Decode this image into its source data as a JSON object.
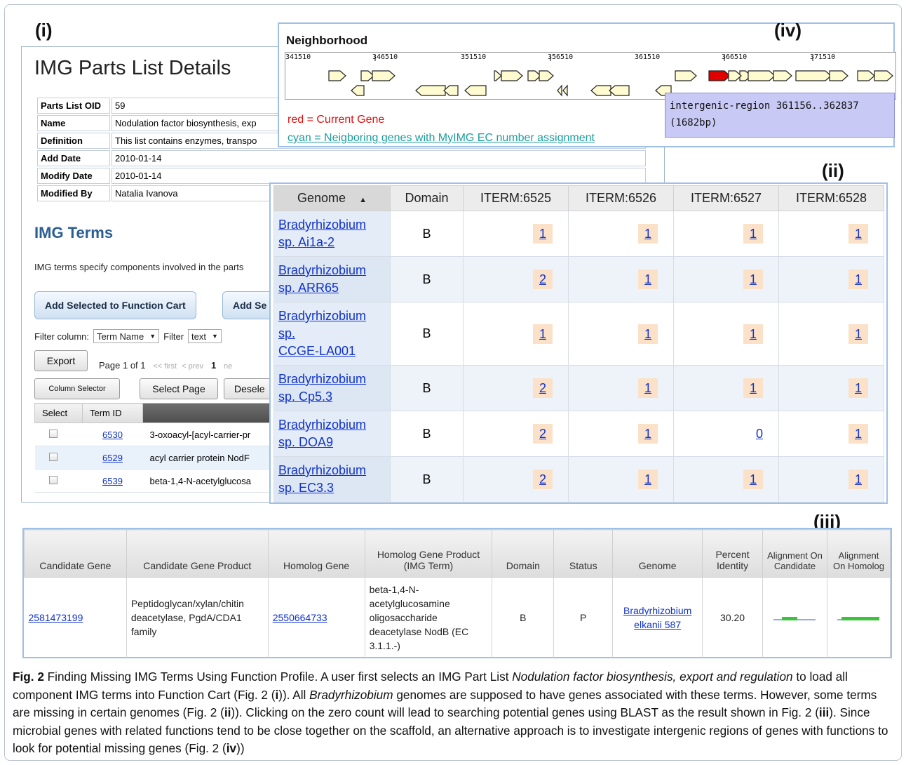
{
  "labels": {
    "i": "(i)",
    "ii": "(ii)",
    "iii": "(iii)",
    "iv": "(iv)"
  },
  "panel_i": {
    "title": "IMG Parts List Details",
    "info": [
      {
        "key": "Parts List OID",
        "value": "59"
      },
      {
        "key": "Name",
        "value": "Nodulation factor biosynthesis, exp"
      },
      {
        "key": "Definition",
        "value": "This list contains enzymes, transpo"
      },
      {
        "key": "Add Date",
        "value": "2010-01-14"
      },
      {
        "key": "Modify Date",
        "value": "2010-01-14"
      },
      {
        "key": "Modified By",
        "value": "Natalia Ivanova"
      }
    ],
    "terms_heading": "IMG Terms",
    "terms_desc": "IMG terms specify components involved in the parts",
    "btn_add_function_cart": "Add Selected to Function Cart",
    "btn_add_second": "Add Se",
    "filter_column_label": "Filter column:",
    "filter_column_value": "Term Name",
    "filter_label": "Filter",
    "filter_value": "text",
    "btn_export": "Export",
    "pager_page": "Page 1 of 1",
    "pager_first": "<< first",
    "pager_prev": "< prev",
    "pager_current": "1",
    "pager_next": "ne",
    "btn_column_selector": "Column Selector",
    "btn_select_page": "Select Page",
    "btn_deselect": "Desele",
    "table_headers": [
      "Select",
      "Term ID",
      ""
    ],
    "rows": [
      {
        "id": "6530",
        "name": "3-oxoacyl-[acyl-carrier-pr"
      },
      {
        "id": "6529",
        "name": "acyl carrier protein NodF"
      },
      {
        "id": "6539",
        "name": "beta-1,4-N-acetylglucosa"
      }
    ]
  },
  "panel_iv": {
    "title": "Neighborhood",
    "coords": [
      "341510",
      "346510",
      "351510",
      "356510",
      "361510",
      "366510",
      "371510"
    ],
    "legend_red": "red = Current Gene",
    "legend_cyan": "cyan = Neigboring genes with MyIMG EC number assignment",
    "tooltip_line1": "intergenic-region 361156..362837",
    "tooltip_line2": "(1682bp)",
    "colors": {
      "current_gene": "#e00000",
      "gene_fill": "#fffbd0"
    }
  },
  "panel_ii": {
    "headers": [
      "Genome",
      "Domain",
      "ITERM:6525",
      "ITERM:6526",
      "ITERM:6527",
      "ITERM:6528"
    ],
    "rows": [
      {
        "genome": [
          "Bradyrhizobium",
          "sp. Ai1a-2"
        ],
        "domain": "B",
        "counts": [
          "1",
          "1",
          "1",
          "1"
        ]
      },
      {
        "genome": [
          "Bradyrhizobium",
          "sp. ARR65"
        ],
        "domain": "B",
        "counts": [
          "2",
          "1",
          "1",
          "1"
        ]
      },
      {
        "genome": [
          "Bradyrhizobium",
          "sp.",
          "CCGE-LA001"
        ],
        "domain": "B",
        "counts": [
          "1",
          "1",
          "1",
          "1"
        ]
      },
      {
        "genome": [
          "Bradyrhizobium",
          "sp. Cp5.3"
        ],
        "domain": "B",
        "counts": [
          "2",
          "1",
          "1",
          "1"
        ]
      },
      {
        "genome": [
          "Bradyrhizobium",
          "sp. DOA9"
        ],
        "domain": "B",
        "counts": [
          "2",
          "1",
          "0",
          "1"
        ]
      },
      {
        "genome": [
          "Bradyrhizobium",
          "sp. EC3.3"
        ],
        "domain": "B",
        "counts": [
          "2",
          "1",
          "1",
          "1"
        ]
      }
    ]
  },
  "panel_iii": {
    "headers": [
      "Candidate Gene",
      "Candidate Gene Product",
      "Homolog Gene",
      "Homolog Gene Product (IMG Term)",
      "Domain",
      "Status",
      "Genome",
      "Percent Identity",
      "Alignment On Candidate",
      "Alignment On Homolog"
    ],
    "row": {
      "candidate_gene": "2581473199",
      "candidate_product": "Peptidoglycan/xylan/chitin deacetylase, PgdA/CDA1 family",
      "homolog_gene": "2550664733",
      "homolog_product": "beta-1,4-N-acetylglucosamine oligosaccharide deacetylase NodB (EC 3.1.1.-)",
      "domain": "B",
      "status": "P",
      "genome": "Bradyrhizobium elkanii 587",
      "percent_identity": "30.20"
    }
  },
  "caption": {
    "fig": "Fig. 2",
    "t1": " Finding Missing IMG Terms Using Function Profile. A user first selects an IMG Part List ",
    "i1": "Nodulation factor biosynthesis, export and regulation",
    "t2": " to load all component IMG terms into Function Cart (Fig. 2 (",
    "b1": "i",
    "t3": ")). All ",
    "i2": "Bradyrhizobium",
    "t4": " genomes are supposed to have genes associated with these terms. However, some terms are missing in certain genomes (Fig. 2 (",
    "b2": "ii",
    "t5": ")). Clicking on the zero count will lead to searching potential genes using BLAST as the result shown in Fig. 2 (",
    "b3": "iii",
    "t6": "). Since microbial genes with related functions tend to be close together on the scaffold, an alternative approach is to investigate intergenic regions of genes with functions to look for potential missing genes (Fig. 2 (",
    "b4": "iv",
    "t7": "))"
  }
}
